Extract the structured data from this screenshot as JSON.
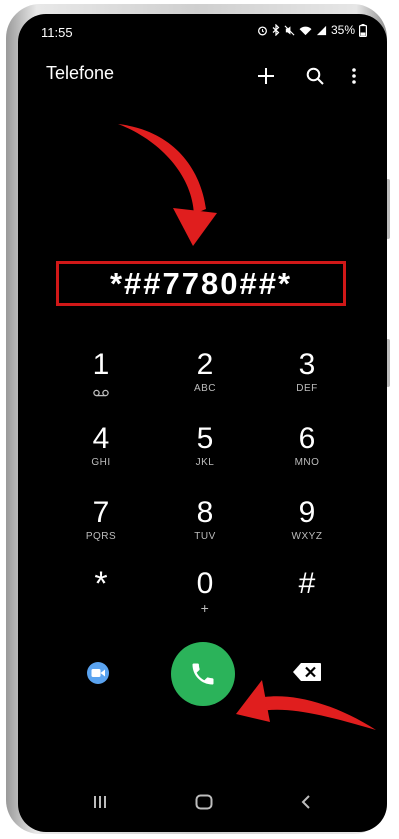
{
  "status_bar": {
    "time": "11:55",
    "battery": "35%",
    "icons": [
      "alarm-icon",
      "bluetooth-icon",
      "mute-icon",
      "wifi-icon",
      "signal-icon",
      "battery-icon"
    ]
  },
  "app_bar": {
    "title": "Telefone",
    "actions": [
      "add-icon",
      "search-icon",
      "more-options-icon"
    ]
  },
  "dialer": {
    "number": "*##7780##*",
    "keys": [
      {
        "digit": "1",
        "sub": "voicemail-icon"
      },
      {
        "digit": "2",
        "sub": "ABC"
      },
      {
        "digit": "3",
        "sub": "DEF"
      },
      {
        "digit": "4",
        "sub": "GHI"
      },
      {
        "digit": "5",
        "sub": "JKL"
      },
      {
        "digit": "6",
        "sub": "MNO"
      },
      {
        "digit": "7",
        "sub": "PQRS"
      },
      {
        "digit": "8",
        "sub": "TUV"
      },
      {
        "digit": "9",
        "sub": "WXYZ"
      },
      {
        "digit": "*",
        "sub": ""
      },
      {
        "digit": "0",
        "sub": "+"
      },
      {
        "digit": "#",
        "sub": ""
      }
    ]
  },
  "bottom_actions": [
    "video-call-icon",
    "call-icon",
    "backspace-icon"
  ],
  "nav_bar": [
    "recent-apps-icon",
    "home-icon",
    "back-icon"
  ],
  "colors": {
    "highlight_box": "#d01818",
    "arrow": "#e01e1e",
    "call_button": "#2bb35a",
    "video_icon": "#5aa3f0"
  }
}
